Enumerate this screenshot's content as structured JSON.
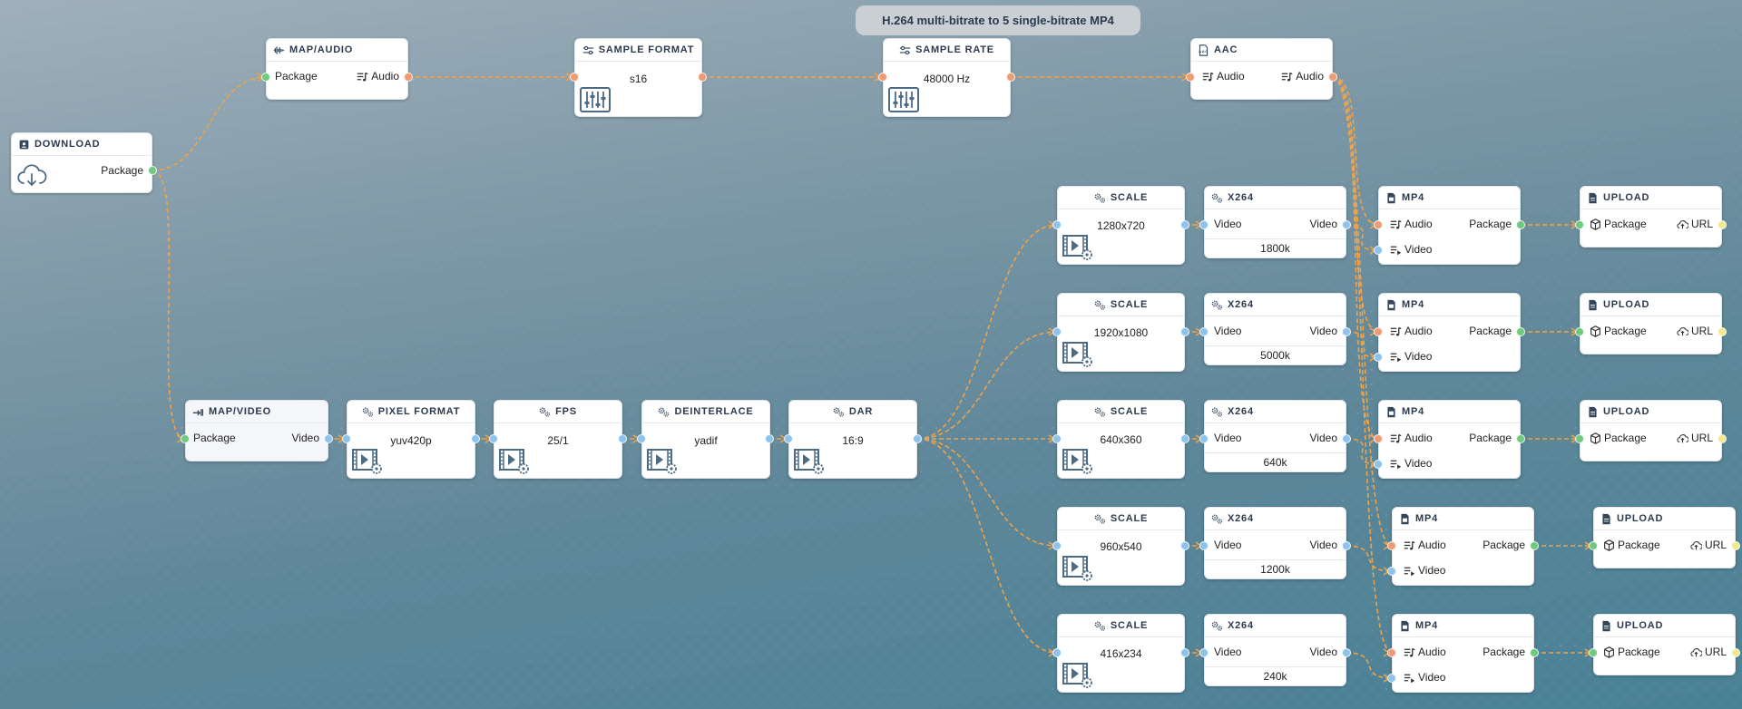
{
  "flow_title": "H.264 multi-bitrate to 5 single-bitrate MP4",
  "colors": {
    "wire": "#eea24a",
    "audio_port": "#ef9c74",
    "video_port": "#8fc3ec",
    "package_port": "#6fc97f",
    "url_port": "#f2ea8f"
  },
  "download": {
    "title": "DOWNLOAD",
    "out": "Package",
    "icon": "cloud-download-icon"
  },
  "map_audio": {
    "title": "MAP/AUDIO",
    "in": "Package",
    "out": "Audio"
  },
  "sample_format": {
    "title": "SAMPLE FORMAT",
    "value": "s16"
  },
  "sample_rate": {
    "title": "SAMPLE RATE",
    "value": "48000 Hz"
  },
  "aac": {
    "title": "AAC",
    "in": "Audio",
    "out": "Audio"
  },
  "map_video": {
    "title": "MAP/VIDEO",
    "in": "Package",
    "out": "Video"
  },
  "pixel_format": {
    "title": "PIXEL FORMAT",
    "value": "yuv420p"
  },
  "fps": {
    "title": "FPS",
    "value": "25/1"
  },
  "deinterlace": {
    "title": "DEINTERLACE",
    "value": "yadif"
  },
  "dar": {
    "title": "DAR",
    "value": "16:9"
  },
  "lanes": [
    {
      "scale": {
        "title": "SCALE",
        "value": "1280x720"
      },
      "x264": {
        "title": "X264",
        "in": "Video",
        "out": "Video",
        "bitrate": "1800k"
      },
      "mp4": {
        "title": "MP4",
        "audio": "Audio",
        "video": "Video",
        "out": "Package"
      },
      "upload": {
        "title": "UPLOAD",
        "in": "Package",
        "out": "URL"
      }
    },
    {
      "scale": {
        "title": "SCALE",
        "value": "1920x1080"
      },
      "x264": {
        "title": "X264",
        "in": "Video",
        "out": "Video",
        "bitrate": "5000k"
      },
      "mp4": {
        "title": "MP4",
        "audio": "Audio",
        "video": "Video",
        "out": "Package"
      },
      "upload": {
        "title": "UPLOAD",
        "in": "Package",
        "out": "URL"
      }
    },
    {
      "scale": {
        "title": "SCALE",
        "value": "640x360"
      },
      "x264": {
        "title": "X264",
        "in": "Video",
        "out": "Video",
        "bitrate": "640k"
      },
      "mp4": {
        "title": "MP4",
        "audio": "Audio",
        "video": "Video",
        "out": "Package"
      },
      "upload": {
        "title": "UPLOAD",
        "in": "Package",
        "out": "URL"
      }
    },
    {
      "scale": {
        "title": "SCALE",
        "value": "960x540"
      },
      "x264": {
        "title": "X264",
        "in": "Video",
        "out": "Video",
        "bitrate": "1200k"
      },
      "mp4": {
        "title": "MP4",
        "audio": "Audio",
        "video": "Video",
        "out": "Package"
      },
      "upload": {
        "title": "UPLOAD",
        "in": "Package",
        "out": "URL"
      }
    },
    {
      "scale": {
        "title": "SCALE",
        "value": "416x234"
      },
      "x264": {
        "title": "X264",
        "in": "Video",
        "out": "Video",
        "bitrate": "240k"
      },
      "mp4": {
        "title": "MP4",
        "audio": "Audio",
        "video": "Video",
        "out": "Package"
      },
      "upload": {
        "title": "UPLOAD",
        "in": "Package",
        "out": "URL"
      }
    }
  ]
}
